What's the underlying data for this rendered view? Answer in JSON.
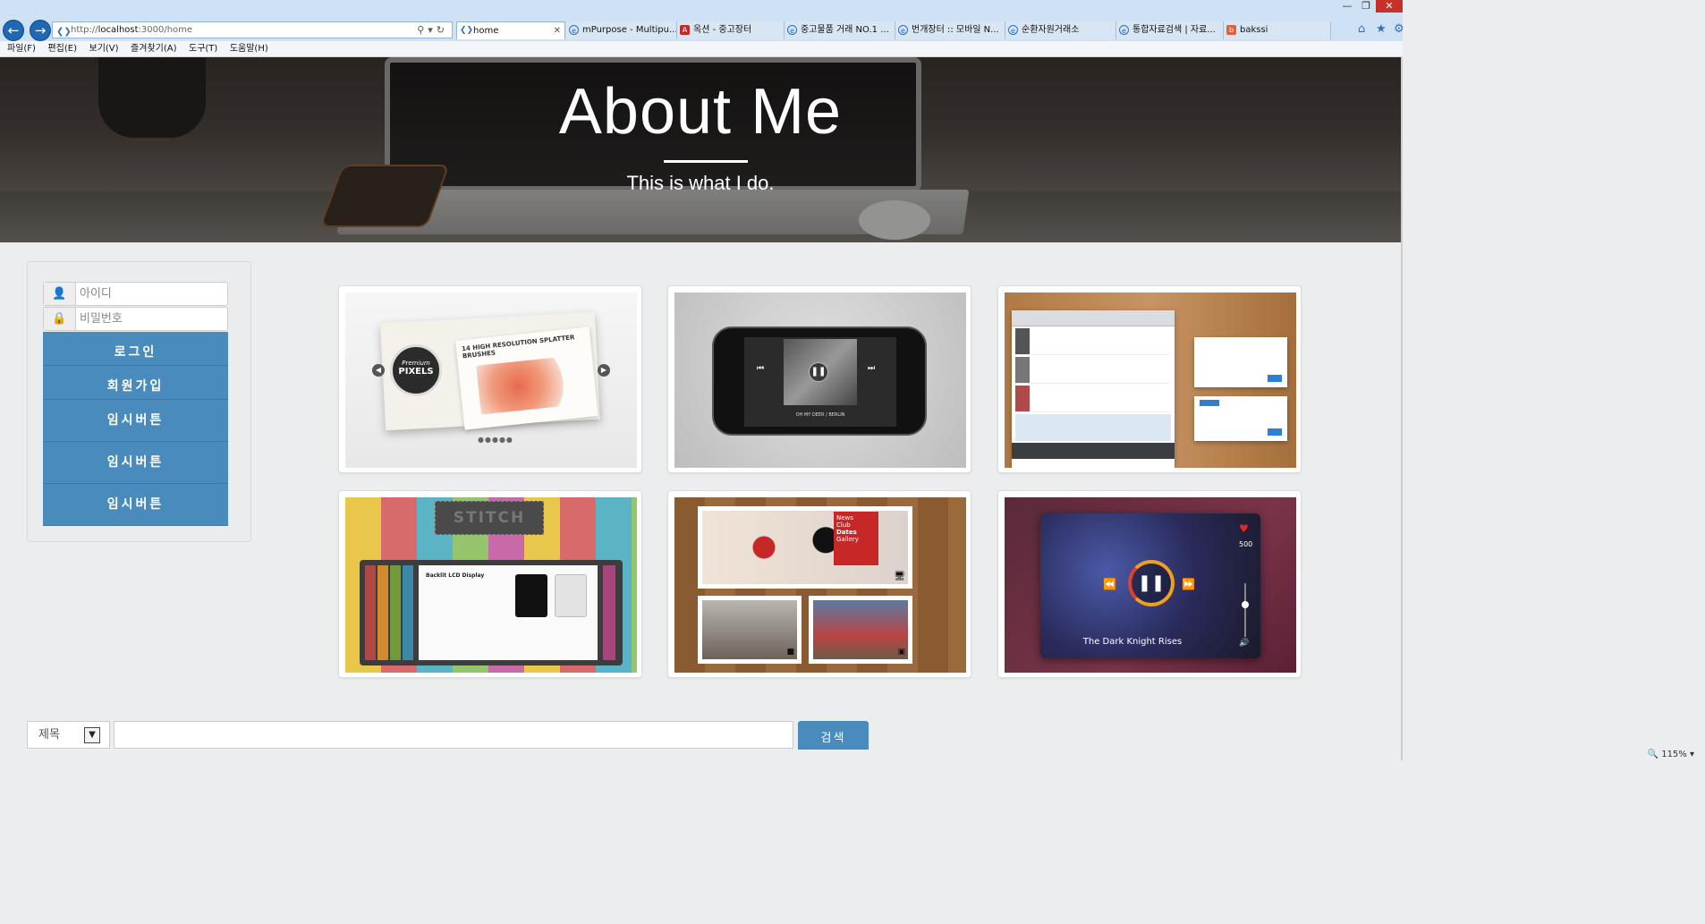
{
  "browser": {
    "address": {
      "prefix": "http://",
      "host": "localhost",
      "rest": ":3000/home"
    },
    "tabs": [
      {
        "label": "home",
        "active": true,
        "icon": "ie-icon",
        "color": "#2a6fb8"
      },
      {
        "label": "mPurpose - Multipu...",
        "icon": "ie-icon",
        "color": "#2a6fb8"
      },
      {
        "label": "옥션 - 중고장터",
        "icon": "auction-icon",
        "color": "#c62828"
      },
      {
        "label": "중고물품 거래 NO.1 ...",
        "icon": "ie-icon",
        "color": "#2a6fb8"
      },
      {
        "label": "번개장터 :: 모바일 N...",
        "icon": "ie-icon",
        "color": "#2a6fb8"
      },
      {
        "label": "순환자원거래소",
        "icon": "ie-icon",
        "color": "#2a6fb8"
      },
      {
        "label": "통합자료검색 | 자료...",
        "icon": "ie-icon",
        "color": "#2a6fb8"
      },
      {
        "label": "bakssi",
        "icon": "bakssi-icon",
        "color": "#e0603a"
      }
    ],
    "menu": [
      "파일(F)",
      "편집(E)",
      "보기(V)",
      "즐겨찾기(A)",
      "도구(T)",
      "도움말(H)"
    ],
    "zoom": "115%"
  },
  "hero": {
    "title": "About Me",
    "subtitle": "This is what I do."
  },
  "login": {
    "id_placeholder": "아이디",
    "pw_placeholder": "비밀번호",
    "buttons": [
      "로그인",
      "회원가입",
      "임시버튼",
      "임시버튼",
      "임시버튼"
    ]
  },
  "portfolio": {
    "items": [
      {
        "name": "premium-pixels-slider",
        "texts": [
          "Premium",
          "PIXELS",
          "14 HIGH RESOLUTION SPLATTER BRUSHES"
        ]
      },
      {
        "name": "iphone-music-player",
        "texts": [
          "OH MY DEER / BERLIN"
        ]
      },
      {
        "name": "twitter-ui-kit",
        "texts": []
      },
      {
        "name": "stitch-ui-kit",
        "texts": [
          "STITCH",
          "Backlit LCD Display"
        ]
      },
      {
        "name": "news-club-board",
        "texts": [
          "News",
          "Club",
          "Dates",
          "Gallery"
        ]
      },
      {
        "name": "dark-knight-player",
        "texts": [
          "The Dark Knight Rises",
          "500"
        ]
      }
    ]
  },
  "search": {
    "select_value": "제목",
    "input_value": "",
    "button_label": "검색"
  }
}
